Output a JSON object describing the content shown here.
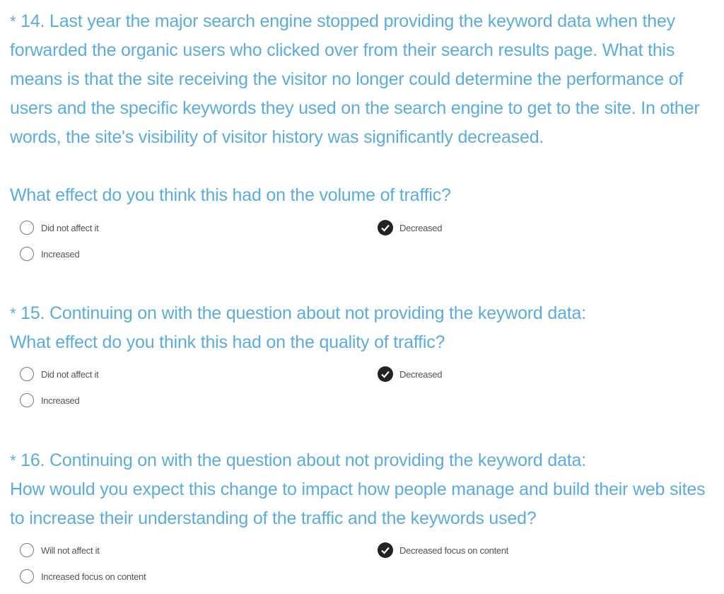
{
  "questions": [
    {
      "star": "*",
      "title": "14. Last year the major search engine stopped providing the keyword data when they forwarded the organic users who clicked over from their search results page. What this means is that the site receiving the visitor no longer could determine the performance of users and the specific keywords they used on the search engine to get to the site. In other words, the site's visibility of visitor history was significantly decreased.",
      "subtitle": "What effect do you think this had on the volume of traffic?",
      "options": [
        {
          "label": "Did not affect it",
          "selected": false
        },
        {
          "label": "Decreased",
          "selected": true
        },
        {
          "label": "Increased",
          "selected": false
        }
      ]
    },
    {
      "star": "*",
      "title": "15. Continuing on with the question about not providing the keyword data:",
      "subtitle": "What effect do you think this had on the quality of traffic?",
      "options": [
        {
          "label": "Did not affect it",
          "selected": false
        },
        {
          "label": "Decreased",
          "selected": true
        },
        {
          "label": "Increased",
          "selected": false
        }
      ]
    },
    {
      "star": "*",
      "title": "16. Continuing on with the question about not providing the keyword data:",
      "subtitle": "How would you expect this change to impact how people manage and build their web sites to increase their understanding of the traffic and the keywords used?",
      "options": [
        {
          "label": "Will not affect it",
          "selected": false
        },
        {
          "label": "Decreased focus on content",
          "selected": true
        },
        {
          "label": "Increased focus on content",
          "selected": false
        }
      ]
    }
  ]
}
